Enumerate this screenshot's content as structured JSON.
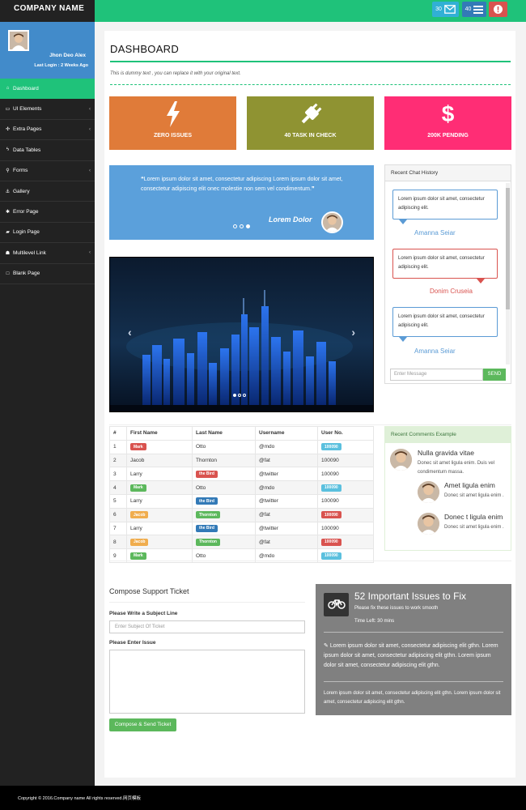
{
  "topbar": {
    "brand": "COMPANY NAME",
    "mail_count": "30",
    "tasks_count": "40"
  },
  "profile": {
    "name": "Jhon Deo Alex",
    "last_login": "Last Login : 2 Weeks Ago"
  },
  "sidebar": {
    "items": [
      {
        "label": "Dashboard",
        "icon": "home-icon",
        "active": true,
        "has_submenu": false
      },
      {
        "label": "UI Elements",
        "icon": "desktop-icon",
        "has_submenu": true
      },
      {
        "label": "Extra Pages",
        "icon": "wrench-icon",
        "has_submenu": true
      },
      {
        "label": "Data Tables",
        "icon": "bolt-icon",
        "has_submenu": false
      },
      {
        "label": "Forms",
        "icon": "bicycle-icon",
        "has_submenu": true
      },
      {
        "label": "Gallery",
        "icon": "anchor-icon",
        "has_submenu": false
      },
      {
        "label": "Error Page",
        "icon": "bug-icon",
        "has_submenu": false
      },
      {
        "label": "Login Page",
        "icon": "car-icon",
        "has_submenu": false
      },
      {
        "label": "Multilevel Link",
        "icon": "sitemap-icon",
        "has_submenu": true
      },
      {
        "label": "Blank Page",
        "icon": "square-icon",
        "has_submenu": false
      }
    ]
  },
  "page": {
    "title": "DASHBOARD",
    "subtitle": "This is dummy text , you can replace it with your original text."
  },
  "stats": [
    {
      "label": "ZERO ISSUES",
      "icon": "bolt-icon",
      "color": "#e07b39"
    },
    {
      "label": "40 TASK IN CHECK",
      "icon": "plug-icon",
      "color": "#8f9332"
    },
    {
      "label": "200K PENDING",
      "icon": "dollar-icon",
      "color": "#ff2d75"
    }
  ],
  "quote": {
    "text": "Lorem ipsum dolor sit amet, consectetur adipiscing Lorem ipsum dolor sit amet, consectetur adipiscing elit onec molestie non sem vel condimentum.",
    "author": "Lorem Dolor"
  },
  "chat": {
    "title": "Recent Chat History",
    "messages": [
      {
        "text": "Lorem ipsum dolor sit amet, consectetur adipiscing elit.",
        "name": "Amanna Seiar"
      },
      {
        "text": "Lorem ipsum dolor sit amet, consectetur adipiscing elit.",
        "name": "Donim Cruseia"
      },
      {
        "text": "Lorem ipsum dolor sit amet, consectetur adipiscing elit.",
        "name": "Amanna Seiar"
      }
    ],
    "input_placeholder": "Enter Message",
    "send_label": "SEND"
  },
  "table": {
    "headers": [
      "#",
      "First Name",
      "Last Name",
      "Username",
      "User No."
    ],
    "rows": [
      {
        "n": "1",
        "first": "Mark",
        "first_label": "red",
        "last": "Otto",
        "last_label": "",
        "user": "@mdo",
        "no": "100090",
        "no_label": "info"
      },
      {
        "n": "2",
        "first": "Jacob",
        "first_label": "",
        "last": "Thornton",
        "last_label": "",
        "user": "@fat",
        "no": "100090",
        "no_label": ""
      },
      {
        "n": "3",
        "first": "Larry",
        "first_label": "",
        "last": "the Bird",
        "last_label": "red",
        "user": "@twitter",
        "no": "100090",
        "no_label": ""
      },
      {
        "n": "4",
        "first": "Mark",
        "first_label": "green",
        "last": "Otto",
        "last_label": "",
        "user": "@mdo",
        "no": "100090",
        "no_label": "info"
      },
      {
        "n": "5",
        "first": "Larry",
        "first_label": "",
        "last": "the Bird",
        "last_label": "blue",
        "user": "@twitter",
        "no": "100090",
        "no_label": ""
      },
      {
        "n": "6",
        "first": "Jacob",
        "first_label": "orange",
        "last": "Thornton",
        "last_label": "green",
        "user": "@fat",
        "no": "100090",
        "no_label": "red"
      },
      {
        "n": "7",
        "first": "Larry",
        "first_label": "",
        "last": "the Bird",
        "last_label": "blue",
        "user": "@twitter",
        "no": "100090",
        "no_label": ""
      },
      {
        "n": "8",
        "first": "Jacob",
        "first_label": "orange",
        "last": "Thornton",
        "last_label": "green",
        "user": "@fat",
        "no": "100090",
        "no_label": "red"
      },
      {
        "n": "9",
        "first": "Mark",
        "first_label": "green",
        "last": "Otto",
        "last_label": "",
        "user": "@mdo",
        "no": "100090",
        "no_label": "info"
      }
    ]
  },
  "comments": {
    "title": "Recent Comments Example",
    "items": [
      {
        "title": "Nulla gravida vitae",
        "text": "Donec sit amet ligula enim. Duis vel condimentum massa."
      },
      {
        "title": "Amet ligula enim",
        "text": "Donec sit amet ligula enim ."
      },
      {
        "title": "Donec t ligula enim",
        "text": "Donec sit amet ligula enim ."
      }
    ]
  },
  "ticket": {
    "title": "Compose Support Ticket",
    "subject_label": "Please Write a Subject Line",
    "subject_placeholder": "Enter Subject Of Ticket",
    "issue_label": "Please Enter Issue",
    "button": "Compose & Send Ticket"
  },
  "issues": {
    "title": "52 Important Issues to Fix",
    "subtitle": "Please fix these issues to work smooth",
    "time_left": "Time Left: 30 mins",
    "body": "Lorem ipsum dolor sit amet, consectetur adipiscing elit gthn. Lorem ipsum dolor sit amet, consectetur adipiscing elit gthn. Lorem ipsum dolor sit amet, consectetur adipiscing elit gthn.",
    "footer": "Lorem ipsum dolor sit amet, consectetur adipiscing elit gthn. Lorem ipsum dolor sit amet, consectetur adipiscing elit gthn."
  },
  "footer": {
    "text": "Copyright © 2016.Company name All rights reserved.网页模板"
  },
  "colors": {
    "accent": "#1fc27a",
    "sidebar": "#222222",
    "profile_bg": "#428bca"
  }
}
